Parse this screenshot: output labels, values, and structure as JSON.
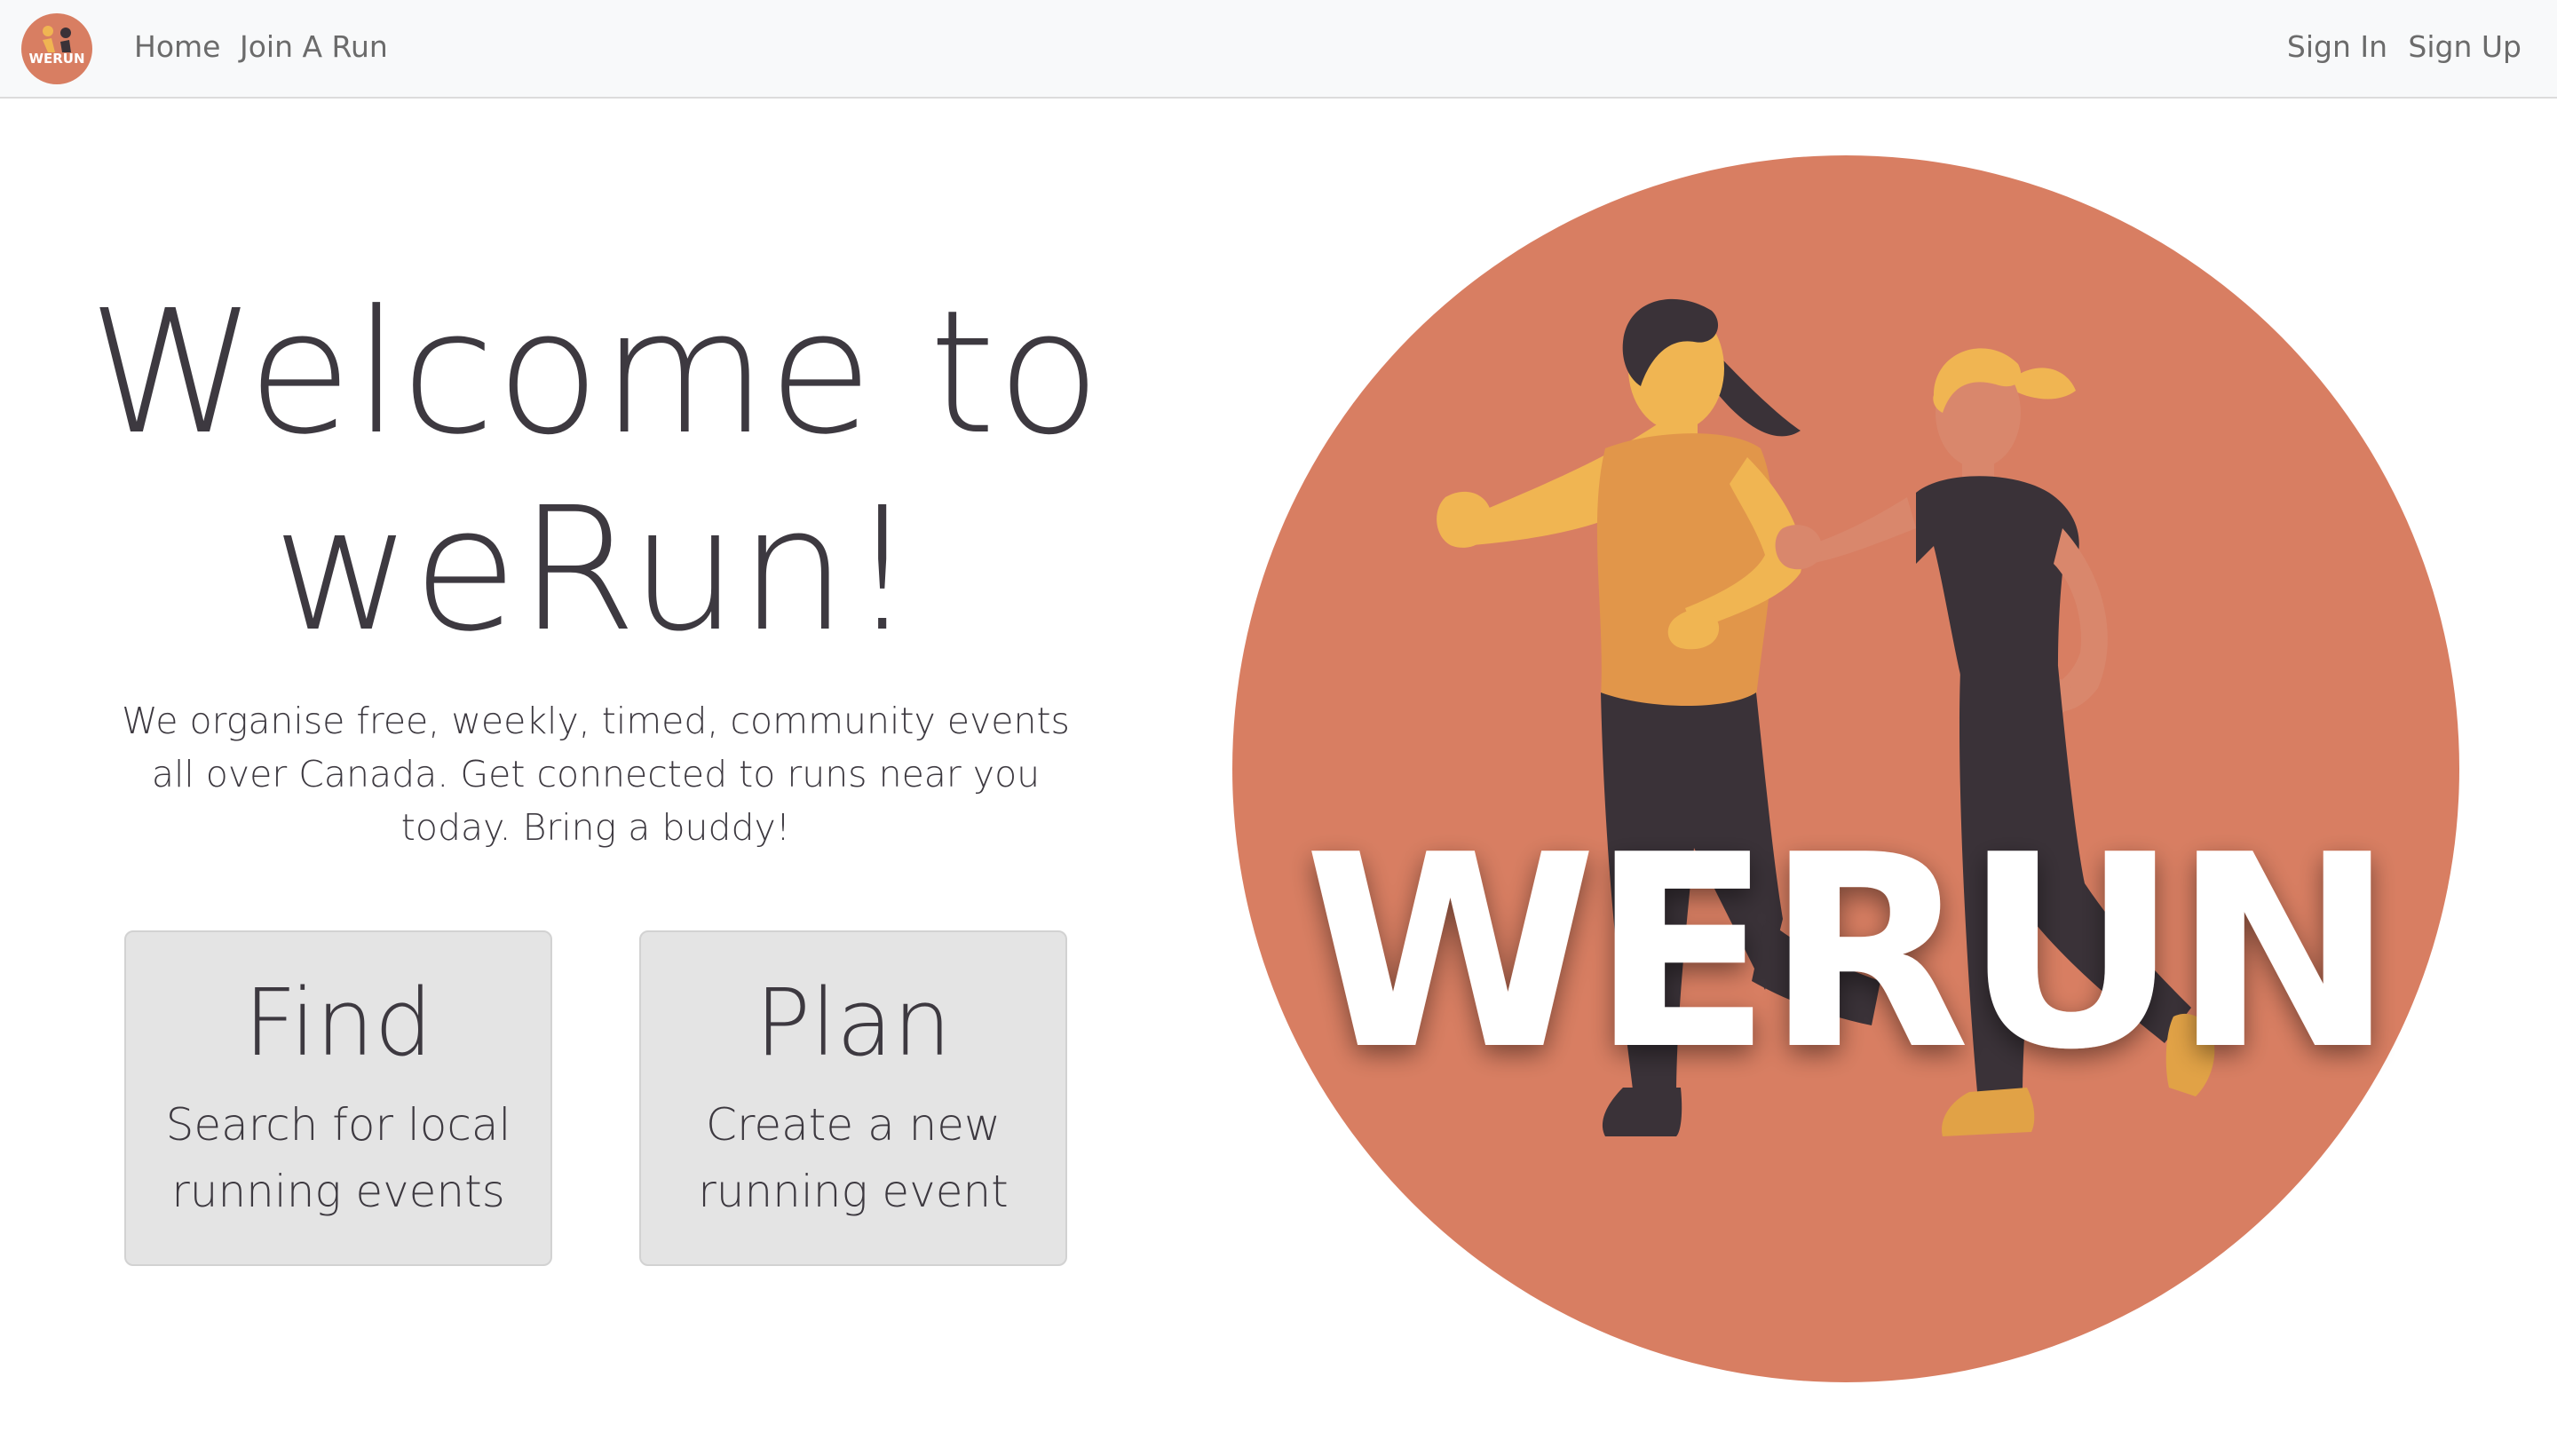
{
  "nav": {
    "logo_text": "WERUN",
    "home": "Home",
    "join": "Join A Run",
    "sign_in": "Sign In",
    "sign_up": "Sign Up"
  },
  "hero": {
    "title_line1": "Welcome to",
    "title_line2": "weRun!",
    "description": "We organise free, weekly, timed, community events all over Canada. Get connected to runs near you today. Bring a buddy!"
  },
  "cards": {
    "find": {
      "title": "Find",
      "description": "Search for local running events"
    },
    "plan": {
      "title": "Plan",
      "description": "Create a new running event"
    }
  },
  "art": {
    "wordmark": "WERUN"
  },
  "colors": {
    "brand_orange": "#d87e62",
    "runner_yellow": "#f0b552",
    "text_dark": "#3d3940",
    "card_bg": "#e4e4e4",
    "nav_bg": "#f8f9fa"
  },
  "icons": {
    "logo": "werun-logo-icon",
    "hero": "runners-illustration"
  }
}
